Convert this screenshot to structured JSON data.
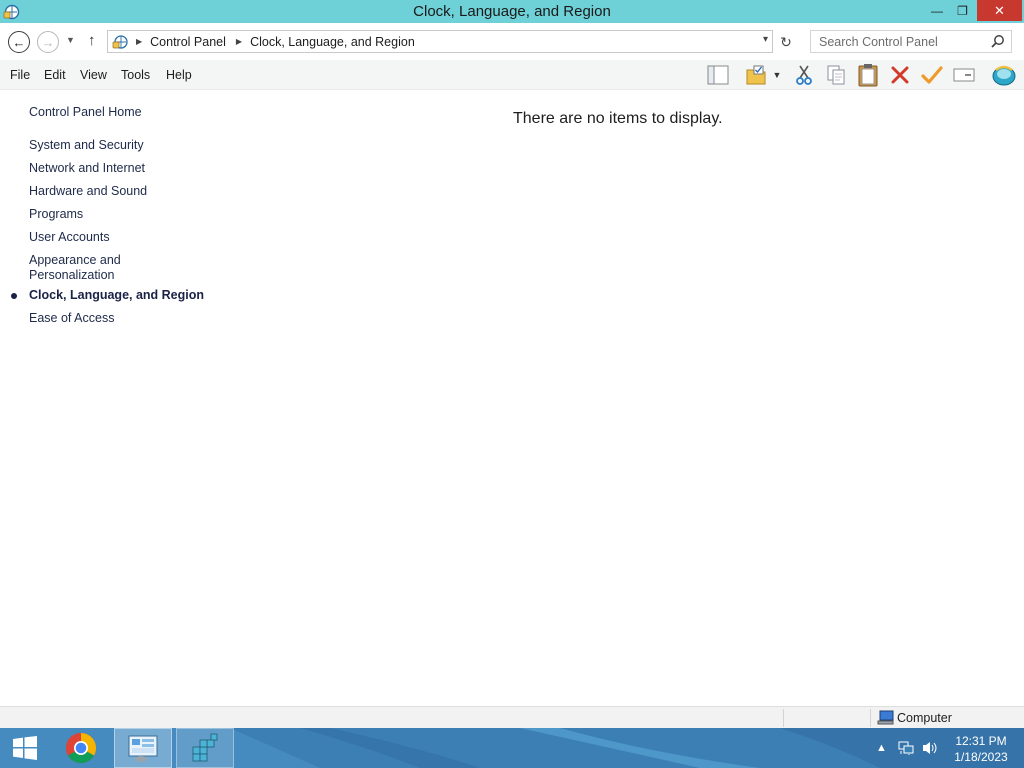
{
  "window": {
    "title": "Clock, Language, and Region",
    "minimize": "—",
    "restore": "❐",
    "close": "✕"
  },
  "address": {
    "breadcrumbs": [
      "Control Panel",
      "Clock, Language, and Region"
    ],
    "search_placeholder": "Search Control Panel"
  },
  "menu": {
    "items": [
      "File",
      "Edit",
      "View",
      "Tools",
      "Help"
    ],
    "toolbar_icons": [
      "layout-pane-icon",
      "select-folder-icon",
      "cut-icon",
      "copy-icon",
      "paste-icon",
      "delete-icon",
      "properties-check-icon",
      "rename-icon",
      "shell-icon"
    ]
  },
  "nav": {
    "home": "Control Panel Home",
    "items": [
      "System and Security",
      "Network and Internet",
      "Hardware and Sound",
      "Programs",
      "User Accounts",
      "Appearance and Personalization",
      "Clock, Language, and Region",
      "Ease of Access"
    ],
    "appearance_line1": "Appearance and",
    "appearance_line2": "Personalization",
    "current_index": 6
  },
  "content": {
    "empty_message": "There are no items to display."
  },
  "status": {
    "location": "Computer"
  },
  "taskbar": {
    "apps": [
      "Google Chrome",
      "Control Panel",
      "Registry Editor"
    ],
    "time": "12:31 PM",
    "date": "1/18/2023"
  },
  "colors": {
    "titlebar": "#6fd1d8",
    "close_button": "#c7392e",
    "taskbar": "#3c7fb5",
    "nav_link": "#1e2a49"
  }
}
